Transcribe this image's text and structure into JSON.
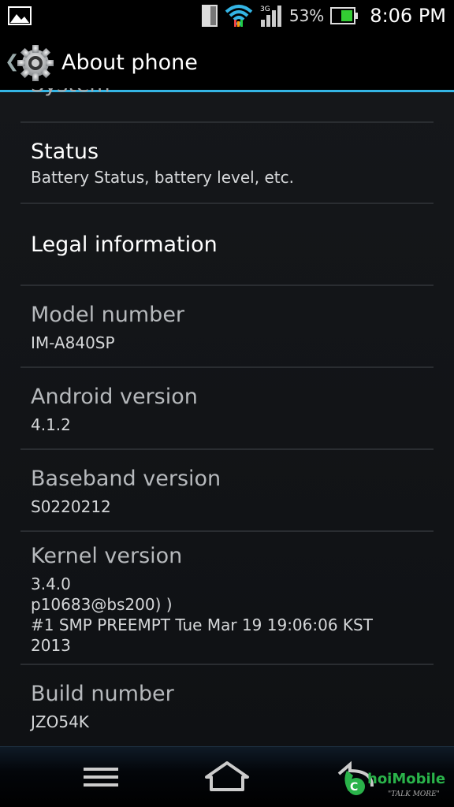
{
  "status_bar": {
    "battery_percent": "53%",
    "time": "8:06 PM",
    "icons": [
      "gallery-icon",
      "sim-icon",
      "wifi-icon",
      "signal-icon",
      "battery-icon"
    ]
  },
  "action_bar": {
    "title": "About phone",
    "icon": "settings-gear-icon",
    "up_icon": "up-caret-icon"
  },
  "items": [
    {
      "label": "Status",
      "value": "Battery Status, battery level, etc."
    },
    {
      "label": "Legal information",
      "value": ""
    },
    {
      "label": "Model number",
      "value": "IM-A840SP"
    },
    {
      "label": "Android version",
      "value": "4.1.2"
    },
    {
      "label": "Baseband version",
      "value": "S0220212"
    },
    {
      "label": "Kernel version",
      "value": "3.4.0\np10683@bs200) )\n#1 SMP PREEMPT Tue Mar 19 19:06:06 KST\n2013"
    },
    {
      "label": "Build number",
      "value": "JZO54K"
    }
  ],
  "nav_bar": {
    "menu_icon": "menu-icon",
    "home_icon": "home-icon",
    "back_icon": "back-icon"
  },
  "watermark": {
    "brand": "hoiMobile",
    "tagline": "\"TALK MORE\""
  },
  "colors": {
    "accent": "#34b5e5",
    "background": "#0f1012"
  }
}
